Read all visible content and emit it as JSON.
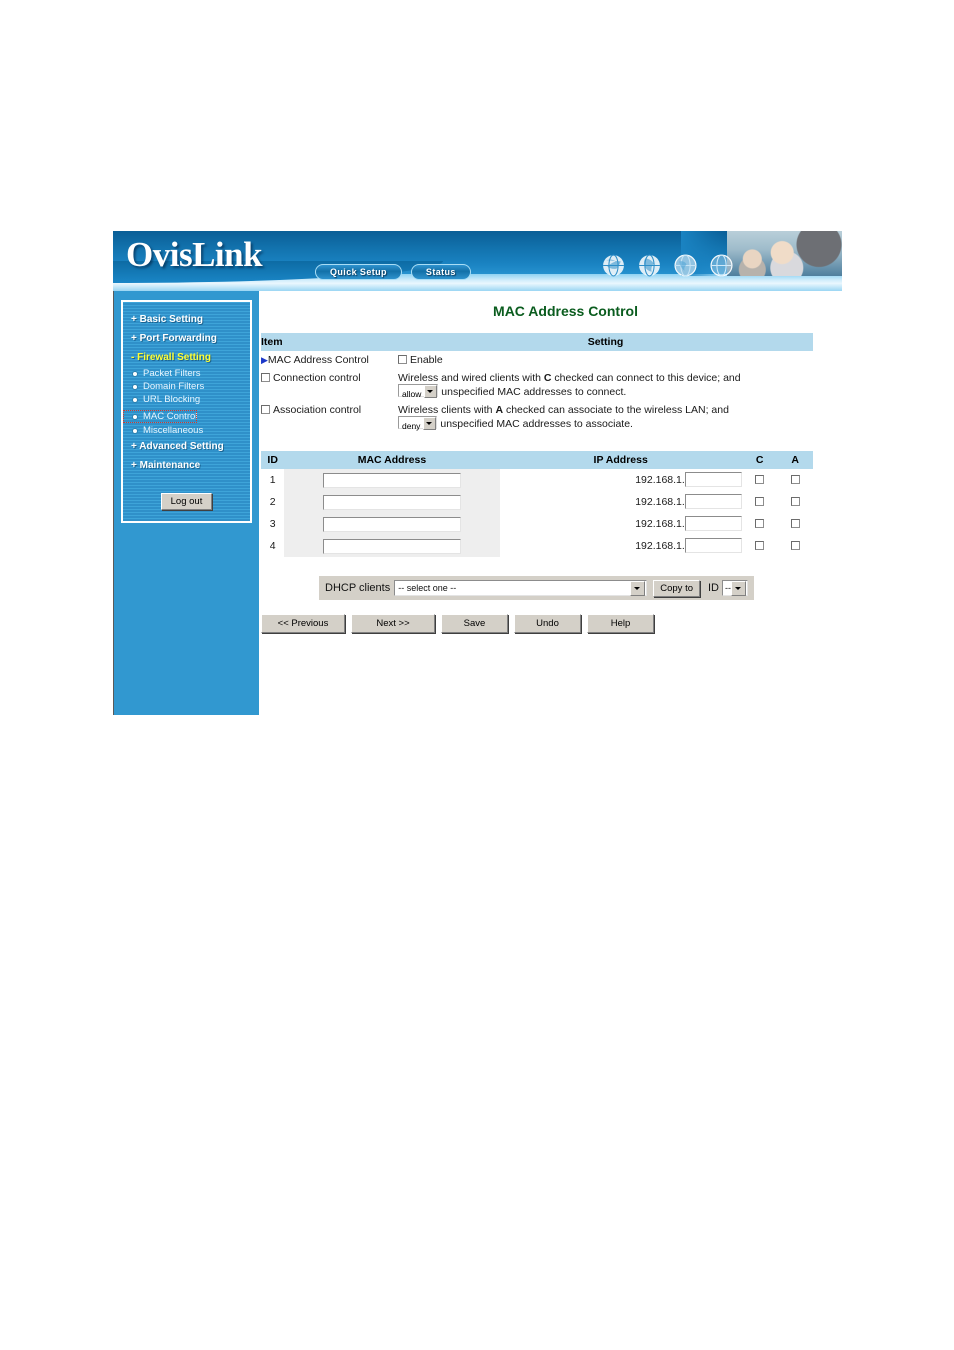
{
  "header": {
    "logo": "OvisLink",
    "nav": [
      {
        "label": "Quick Setup",
        "name": "quick-setup"
      },
      {
        "label": "Status",
        "name": "status"
      }
    ],
    "globe_icons": [
      "globe-icon-1",
      "globe-icon-2",
      "globe-icon-3",
      "globe-icon-4"
    ],
    "banner_photo": "people-photo"
  },
  "sidebar": {
    "items": [
      {
        "label": "+ Basic Setting",
        "type": "top",
        "active": false
      },
      {
        "label": "+ Port Forwarding",
        "type": "top",
        "active": false
      },
      {
        "label": "- Firewall Setting",
        "type": "top",
        "active": true
      },
      {
        "label": "Packet Filters",
        "type": "sub",
        "focused": false
      },
      {
        "label": "Domain Filters",
        "type": "sub",
        "focused": false
      },
      {
        "label": "URL Blocking",
        "type": "sub",
        "focused": false
      },
      {
        "label": "MAC Control",
        "type": "sub",
        "focused": true
      },
      {
        "label": "Miscellaneous",
        "type": "sub",
        "focused": false
      },
      {
        "label": "+ Advanced Setting",
        "type": "top",
        "active": false
      },
      {
        "label": "+ Maintenance",
        "type": "top",
        "active": false
      }
    ],
    "logout_label": "Log out"
  },
  "main": {
    "page_title": "MAC Address Control",
    "settings_table": {
      "headers": {
        "item": "Item",
        "setting": "Setting"
      },
      "rows": [
        {
          "item_label": "MAC Address Control",
          "item_marker": "arrow",
          "checkbox_label": "Enable",
          "checked": false
        },
        {
          "item_label": "Connection control",
          "item_marker": "checkbox",
          "checked": false,
          "text_before": "Wireless and wired clients with ",
          "bold_letter": "C",
          "text_after": " checked can connect to this device; and",
          "select_value": "allow",
          "text_tail": " unspecified MAC addresses to connect."
        },
        {
          "item_label": "Association control",
          "item_marker": "checkbox",
          "checked": false,
          "text_before": "Wireless clients with ",
          "bold_letter": "A",
          "text_after": " checked can associate to the wireless LAN; and",
          "select_value": "deny",
          "text_tail": " unspecified MAC addresses to associate."
        }
      ]
    },
    "mac_table": {
      "headers": [
        "ID",
        "MAC Address",
        "IP Address",
        "C",
        "A"
      ],
      "ip_prefix": "192.168.1.",
      "rows": [
        {
          "id": "1",
          "mac": "",
          "ip_suffix": "",
          "c": false,
          "a": false
        },
        {
          "id": "2",
          "mac": "",
          "ip_suffix": "",
          "c": false,
          "a": false
        },
        {
          "id": "3",
          "mac": "",
          "ip_suffix": "",
          "c": false,
          "a": false
        },
        {
          "id": "4",
          "mac": "",
          "ip_suffix": "",
          "c": false,
          "a": false
        }
      ]
    },
    "dhcp_panel": {
      "label": "DHCP clients",
      "select_value": "-- select one --",
      "copy_button": "Copy to",
      "id_label": "ID",
      "id_value": "--"
    },
    "buttons": [
      {
        "label": "<< Previous",
        "name": "previous-button",
        "size": "wide"
      },
      {
        "label": "Next >>",
        "name": "next-button",
        "size": "wide"
      },
      {
        "label": "Save",
        "name": "save-button",
        "size": "med"
      },
      {
        "label": "Undo",
        "name": "undo-button",
        "size": "med"
      },
      {
        "label": "Help",
        "name": "help-button",
        "size": "med"
      }
    ]
  },
  "colors": {
    "header_blue": "#1a83c2",
    "sidebar_blue": "#3198d0",
    "table_header_blue": "#b3d9ec",
    "title_green": "#0a5c1e",
    "active_menu_yellow": "#ffff33"
  }
}
